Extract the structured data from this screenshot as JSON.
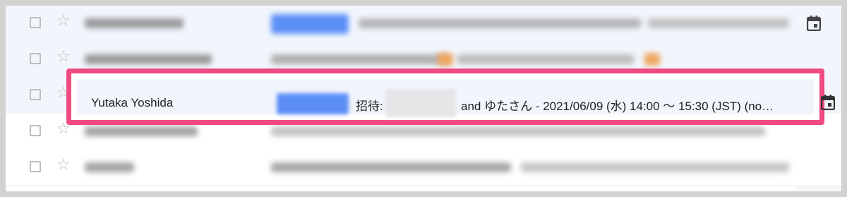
{
  "rows": [
    {
      "highlighted": false
    },
    {
      "highlighted": false
    },
    {
      "highlighted": true,
      "sender": "Yutaka Yoshida",
      "subject_prefix": "招待:",
      "subject_rest": "and ゆたさん - 2021/06/09 (水) 14:00 〜 15:30 (JST) (no…"
    },
    {
      "highlighted": false
    },
    {
      "highlighted": false
    }
  ],
  "icons": {
    "checkbox": "checkbox-icon",
    "star": "star-icon",
    "calendar": "calendar-icon",
    "star_glyph": "☆"
  },
  "colors": {
    "highlight_border": "#ef4b82",
    "label_blue": "#5c8ff5",
    "row_unread_bg": "#f2f6fc"
  }
}
